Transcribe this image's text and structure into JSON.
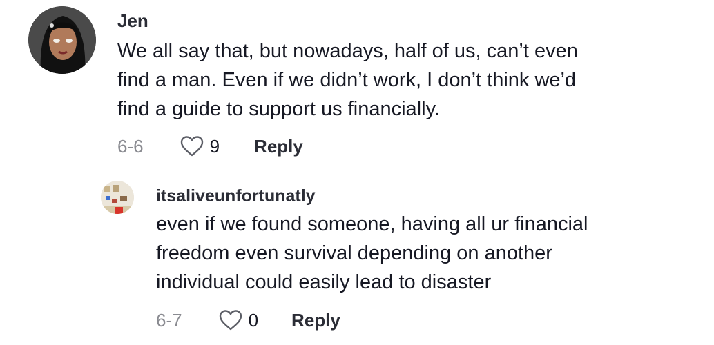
{
  "comments": [
    {
      "username": "Jen",
      "lines": [
        "We all say that, but nowadays, half of us, can’t even",
        "find a man. Even if we didn’t work, I don’t think we’d",
        "find a guide to support us financially."
      ],
      "date": "6-6",
      "likes": "9",
      "reply_label": "Reply"
    },
    {
      "username": "itsaliveunfortunatly",
      "lines": [
        "even if we found someone, having all ur financial",
        "freedom even survival depending on another",
        "individual could easily lead to disaster"
      ],
      "date": "6-7",
      "likes": "0",
      "reply_label": "Reply"
    }
  ],
  "icons": {
    "like": "heart-outline-icon"
  },
  "colors": {
    "text": "#161823",
    "muted": "#8a8b91",
    "heart_stroke": "#5c5e66"
  }
}
